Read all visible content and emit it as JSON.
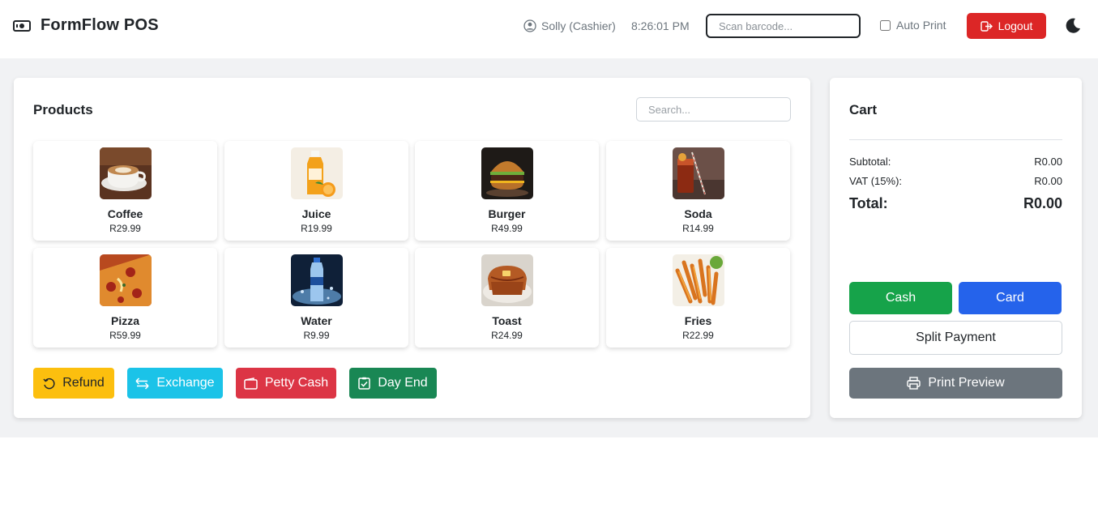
{
  "navbar": {
    "brand": "FormFlow POS",
    "brand_icon": "cash-register-icon",
    "user": "Solly (Cashier)",
    "time": "8:26:01 PM",
    "scan_placeholder": "Scan barcode...",
    "auto_print_label": "Auto Print",
    "auto_print_checked": false,
    "logout_label": "Logout",
    "theme_icon": "moon-icon"
  },
  "products": {
    "title": "Products",
    "search_placeholder": "Search...",
    "items": [
      {
        "name": "Coffee",
        "price": "R29.99",
        "image": "coffee-image"
      },
      {
        "name": "Juice",
        "price": "R19.99",
        "image": "juice-image"
      },
      {
        "name": "Burger",
        "price": "R49.99",
        "image": "burger-image"
      },
      {
        "name": "Soda",
        "price": "R14.99",
        "image": "soda-image"
      },
      {
        "name": "Pizza",
        "price": "R59.99",
        "image": "pizza-image"
      },
      {
        "name": "Water",
        "price": "R9.99",
        "image": "water-image"
      },
      {
        "name": "Toast",
        "price": "R24.99",
        "image": "toast-image"
      },
      {
        "name": "Fries",
        "price": "R22.99",
        "image": "fries-image"
      }
    ],
    "actions": {
      "refund": "Refund",
      "exchange": "Exchange",
      "petty_cash": "Petty Cash",
      "day_end": "Day End"
    }
  },
  "cart": {
    "title": "Cart",
    "subtotal_label": "Subtotal:",
    "subtotal_value": "R0.00",
    "vat_label": "VAT (15%):",
    "vat_value": "R0.00",
    "total_label": "Total:",
    "total_value": "R0.00",
    "cash_label": "Cash",
    "card_label": "Card",
    "split_label": "Split Payment",
    "print_preview_label": "Print Preview"
  },
  "colors": {
    "logout": "#dc2626",
    "refund": "#fcbf0e",
    "exchange": "#1bc3e8",
    "petty_cash": "#dc3545",
    "day_end": "#198754",
    "cash": "#16a34a",
    "card": "#2563eb",
    "print_preview": "#6c757d"
  }
}
